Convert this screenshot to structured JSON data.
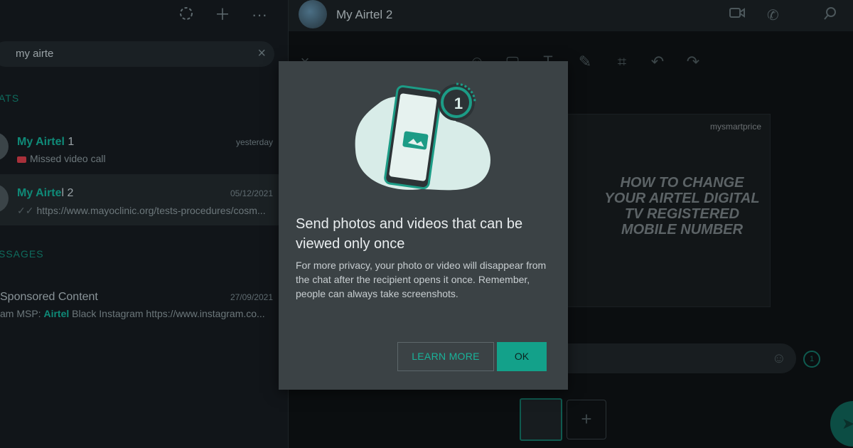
{
  "left": {
    "search": {
      "value": "my airte"
    },
    "sections": {
      "chats": "ATS",
      "messages": "SSAGES"
    },
    "chats": [
      {
        "title_hl": "My Airtel",
        "title_rest": " 1",
        "date": "yesterday",
        "preview": "Missed video call"
      },
      {
        "title_hl": "My Airte",
        "title_rest": "l 2",
        "date": "05/12/2021",
        "preview": "https://www.mayoclinic.org/tests-procedures/cosm..."
      }
    ],
    "message_result": {
      "title": "Sponsored Content",
      "date": "27/09/2021",
      "preview_pre": "am MSP: ",
      "preview_hl": "Airtel",
      "preview_post": " Black Instagram https://www.instagram.co..."
    }
  },
  "header": {
    "name": "My Airtel 2"
  },
  "image": {
    "brand": "mysmartprice",
    "headline": "HOW TO CHANGE YOUR AIRTEL DIGITAL TV REGISTERED MOBILE NUMBER"
  },
  "modal": {
    "badge": "1",
    "title": "Send photos and videos that can be viewed only once",
    "body": "For more privacy, your photo or video will disappear from the chat after the recipient opens it once. Remember, people can always take screenshots.",
    "learn_more": "LEARN MORE",
    "ok": "OK"
  },
  "colors": {
    "accent": "#13a18a",
    "modal_bg": "#3b4245",
    "badge_ring": "#1c9c86"
  }
}
